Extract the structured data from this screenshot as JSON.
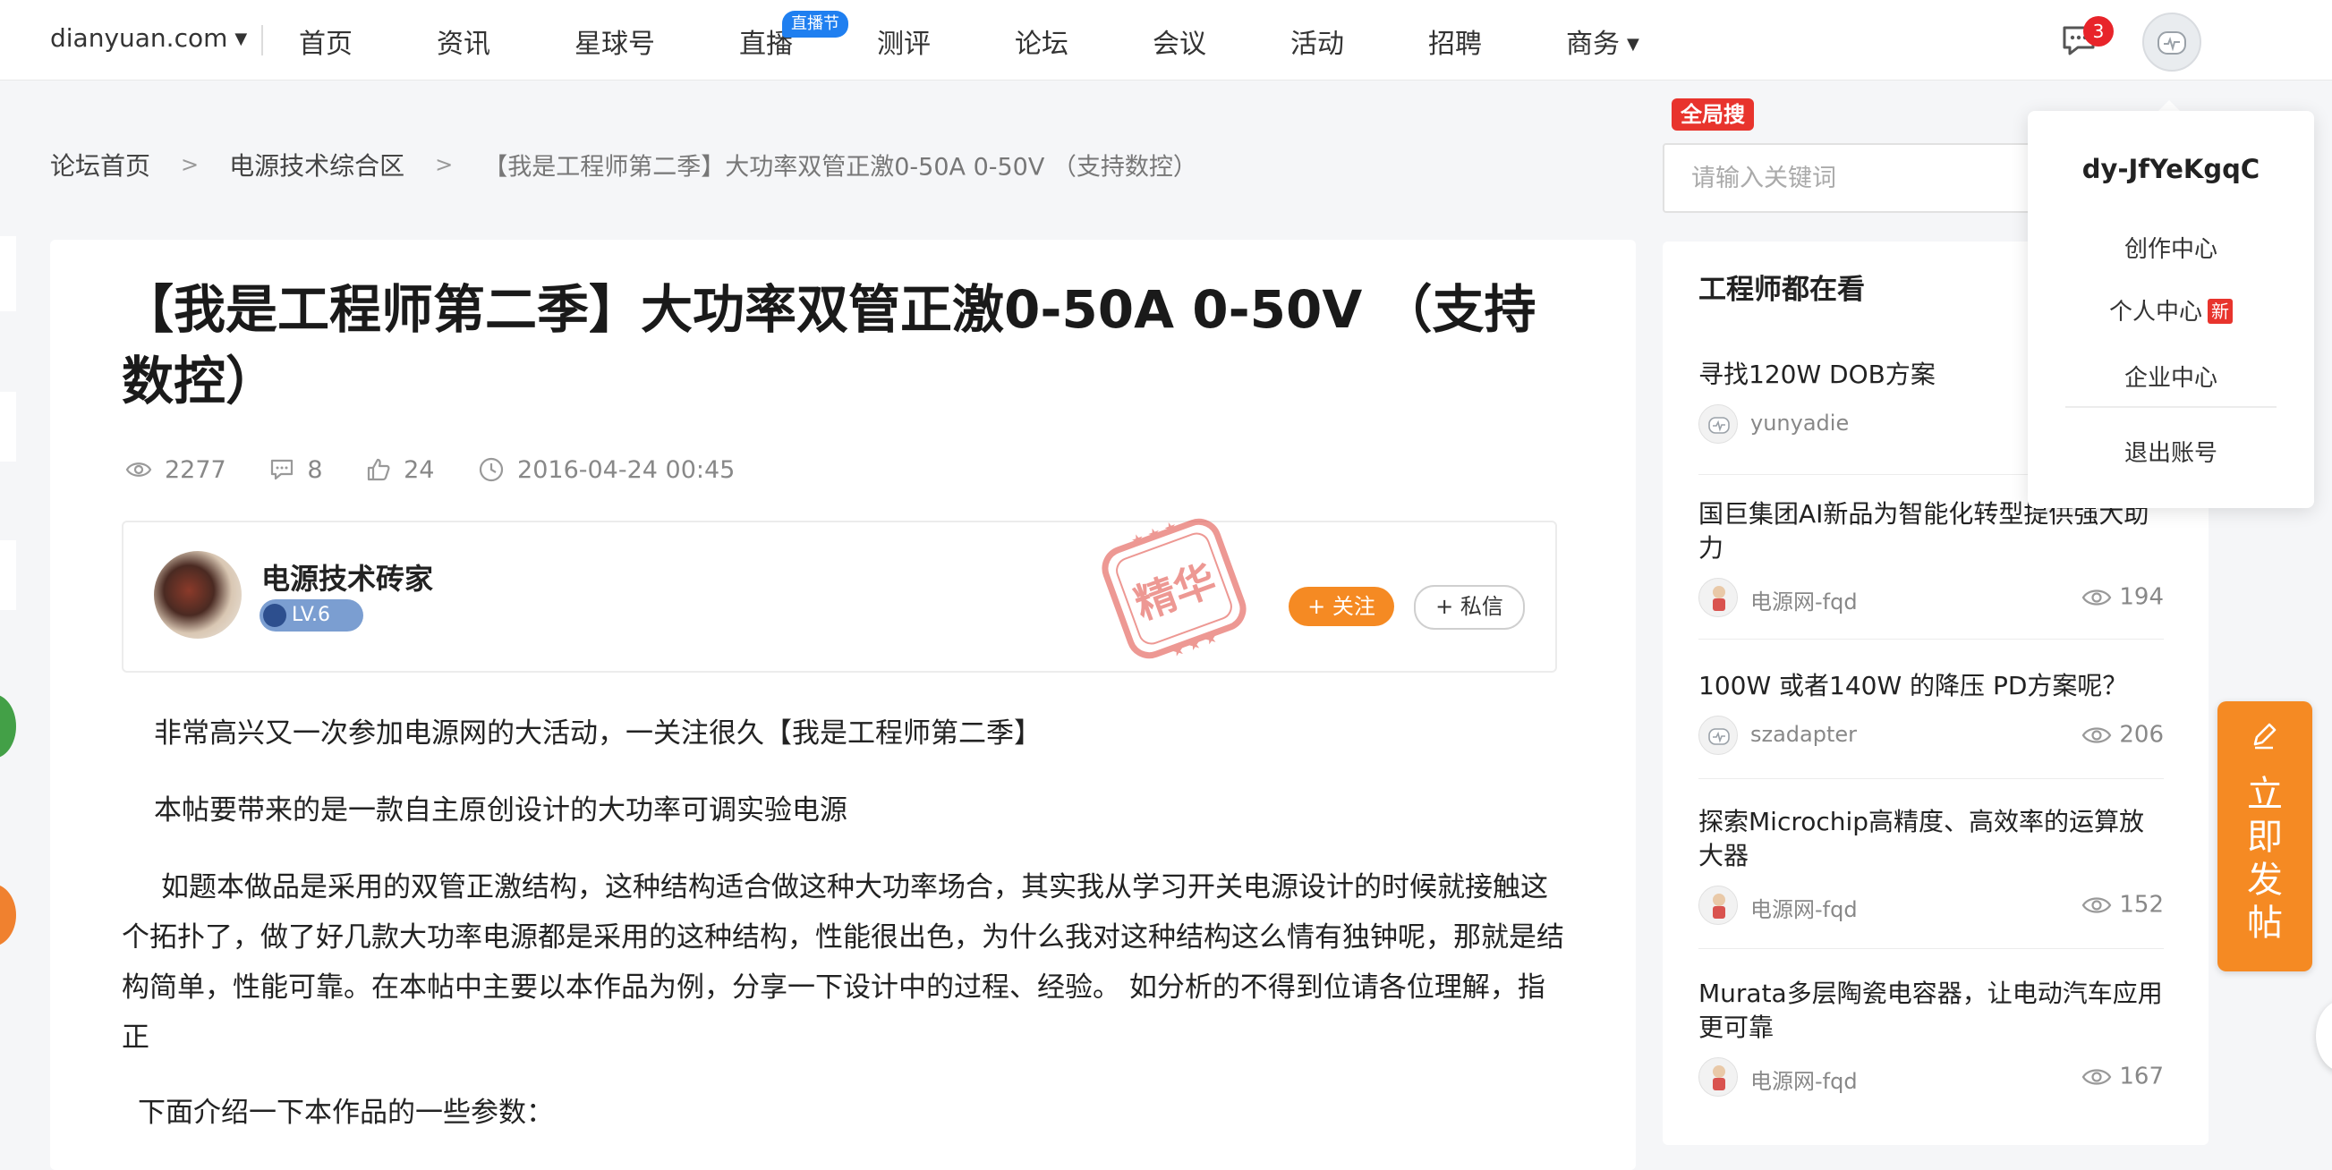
{
  "nav": {
    "site": "dianyuan.com",
    "items": [
      "首页",
      "资讯",
      "星球号",
      "直播",
      "测评",
      "论坛",
      "会议",
      "活动",
      "招聘",
      "商务"
    ],
    "live_badge": "直播节",
    "message_count": "3"
  },
  "breadcrumb": {
    "home": "论坛首页",
    "section": "电源技术综合区",
    "current": "【我是工程师第二季】大功率双管正激0-50A 0-50V （支持数控）"
  },
  "article": {
    "title": "【我是工程师第二季】大功率双管正激0-50A 0-50V （支持数控）",
    "views": "2277",
    "comments": "8",
    "likes": "24",
    "date": "2016-04-24 00:45",
    "author": {
      "name": "电源技术砖家",
      "level": "LV.6",
      "follow_label": "+ 关注",
      "message_label": "+ 私信"
    },
    "stamp": "精华",
    "paragraphs": [
      "非常高兴又一次参加电源网的大活动，一关注很久【我是工程师第二季】",
      "本帖要带来的是一款自主原创设计的大功率可调实验电源",
      "如题本做品是采用的双管正激结构，这种结构适合做这种大功率场合，其实我从学习开关电源设计的时候就接触这个拓扑了，做了好几款大功率电源都是采用的这种结构，性能很出色，为什么我对这种结构这么情有独钟呢，那就是结构简单，性能可靠。在本帖中主要以本作品为例，分享一下设计中的过程、经验。 如分析的不得到位请各位理解，指正",
      "下面介绍一下本作品的一些参数："
    ]
  },
  "search": {
    "badge": "全局搜",
    "placeholder": "请输入关键词"
  },
  "sidebar": {
    "title": "工程师都在看",
    "items": [
      {
        "title": "寻找120W DOB方案",
        "author": "yunyadie",
        "views": ""
      },
      {
        "title": "国巨集团AI新品为智能化转型提供强大助力",
        "author": "电源网-fqd",
        "views": "194"
      },
      {
        "title": "100W 或者140W 的降压 PD方案呢？",
        "author": "szadapter",
        "views": "206"
      },
      {
        "title": "探索Microchip高精度、高效率的运算放大器",
        "author": "电源网-fqd",
        "views": "152"
      },
      {
        "title": "Murata多层陶瓷电容器，让电动汽车应用更可靠",
        "author": "电源网-fqd",
        "views": "167"
      }
    ]
  },
  "user_menu": {
    "username": "dy-JfYeKgqC",
    "creator_center": "创作中心",
    "personal_center": "个人中心",
    "new_tag": "新",
    "enterprise_center": "企业中心",
    "logout": "退出账号"
  },
  "post_button": {
    "label": "立即发帖"
  },
  "colors": {
    "accent_orange": "#f58a23",
    "badge_red": "#e8342d",
    "live_blue": "#1f7ff0",
    "level_blue": "#7b9ed1"
  }
}
